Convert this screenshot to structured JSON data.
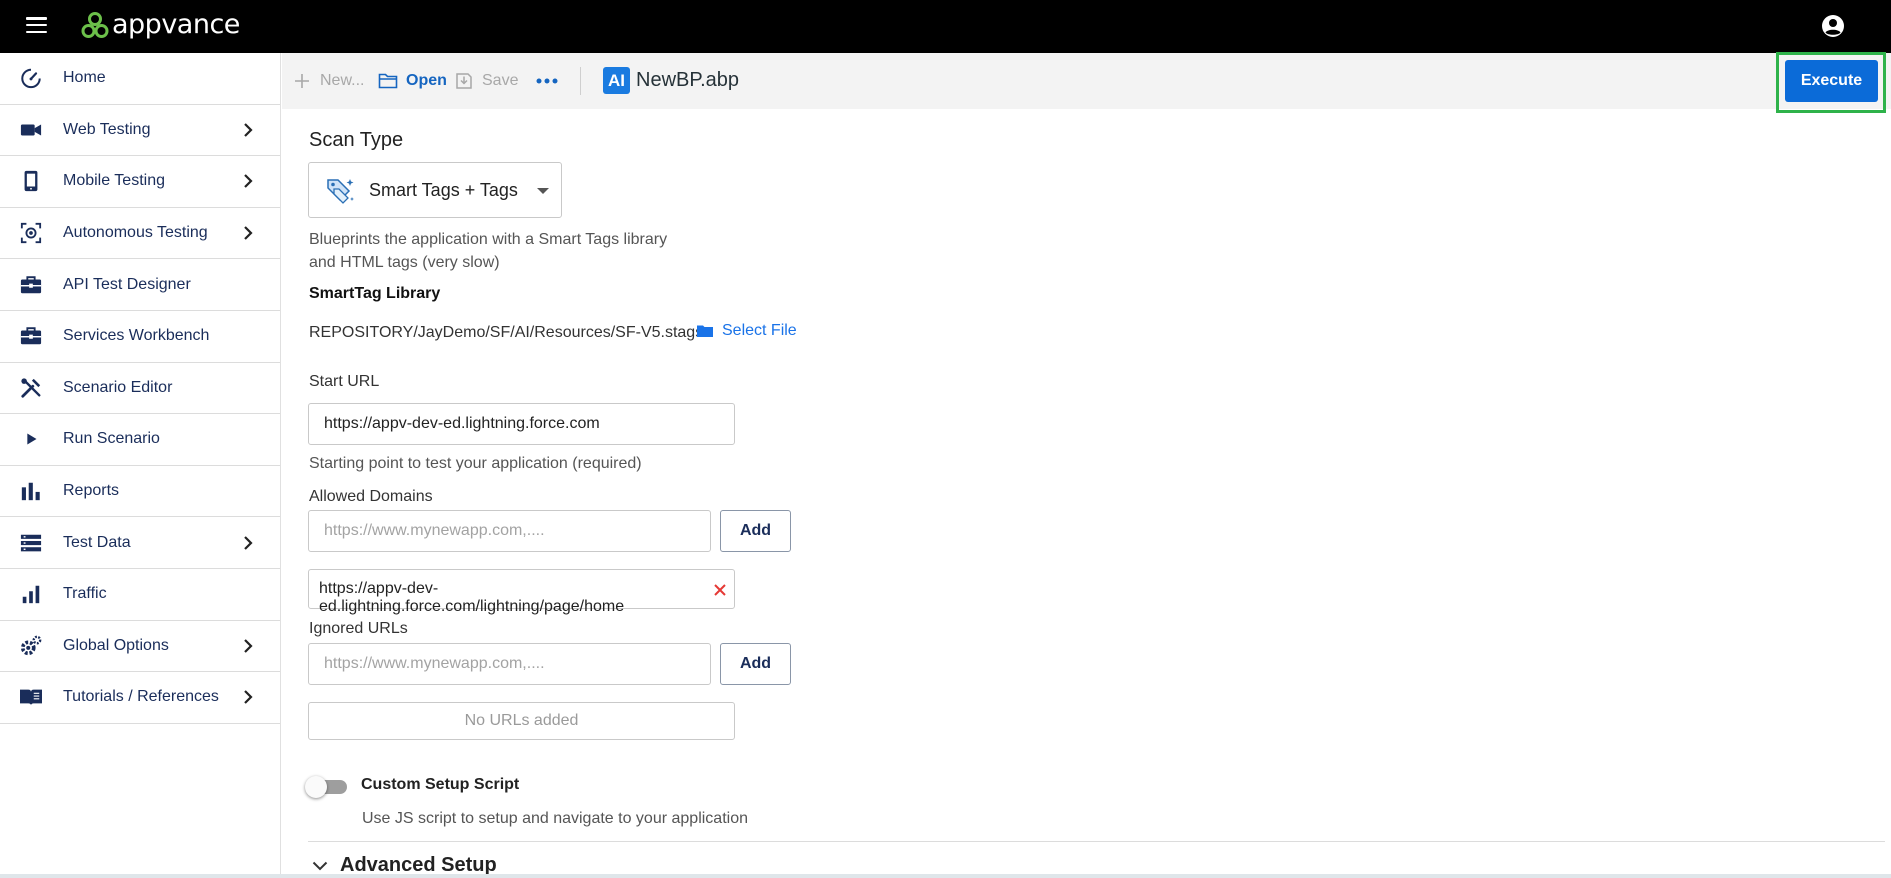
{
  "app": {
    "logo_text": "appvance",
    "brand_colors": {
      "logo_green": "#6cc04a",
      "accent_blue": "#0b6bd8",
      "highlight_green": "#2eb24a"
    }
  },
  "sidebar": {
    "items": [
      {
        "label": "Home",
        "icon": "speedometer-icon",
        "has_submenu": false
      },
      {
        "label": "Web Testing",
        "icon": "video-camera-icon",
        "has_submenu": true
      },
      {
        "label": "Mobile Testing",
        "icon": "smartphone-icon",
        "has_submenu": true
      },
      {
        "label": "Autonomous Testing",
        "icon": "ai-scan-icon",
        "has_submenu": true
      },
      {
        "label": "API Test Designer",
        "icon": "briefcase-icon",
        "has_submenu": false
      },
      {
        "label": "Services Workbench",
        "icon": "briefcase-icon",
        "has_submenu": false
      },
      {
        "label": "Scenario Editor",
        "icon": "tools-icon",
        "has_submenu": false
      },
      {
        "label": "Run Scenario",
        "icon": "play-icon",
        "has_submenu": false
      },
      {
        "label": "Reports",
        "icon": "bar-chart-icon",
        "has_submenu": false
      },
      {
        "label": "Test Data",
        "icon": "list-icon",
        "has_submenu": true
      },
      {
        "label": "Traffic",
        "icon": "signal-bars-icon",
        "has_submenu": false
      },
      {
        "label": "Global Options",
        "icon": "gears-icon",
        "has_submenu": true
      },
      {
        "label": "Tutorials / References",
        "icon": "book-icon",
        "has_submenu": true
      }
    ]
  },
  "toolbar": {
    "new_label": "New...",
    "open_label": "Open",
    "save_label": "Save",
    "file_badge": "AI",
    "file_name": "NewBP.abp",
    "execute_label": "Execute"
  },
  "scan": {
    "title": "Scan Type",
    "selected": "Smart Tags + Tags",
    "description": "Blueprints the application with a Smart Tags library and HTML tags (very slow)"
  },
  "library": {
    "title": "SmartTag Library",
    "path": "REPOSITORY/JayDemo/SF/AI/Resources/SF-V5.stags",
    "select_file_label": "Select File"
  },
  "start_url": {
    "label": "Start URL",
    "value": "https://appv-dev-ed.lightning.force.com",
    "help": "Starting point to test your application (required)"
  },
  "allowed_domains": {
    "label": "Allowed Domains",
    "placeholder": "https://www.mynewapp.com,....",
    "add_label": "Add",
    "entries": [
      "https://appv-dev-ed.lightning.force.com/lightning/page/home"
    ]
  },
  "ignored_urls": {
    "label": "Ignored URLs",
    "placeholder": "https://www.mynewapp.com,....",
    "add_label": "Add",
    "empty_text": "No URLs added"
  },
  "setup_script": {
    "title": "Custom Setup Script",
    "description": "Use JS script to setup and navigate to your application",
    "enabled": false
  },
  "advanced": {
    "title": "Advanced Setup"
  }
}
